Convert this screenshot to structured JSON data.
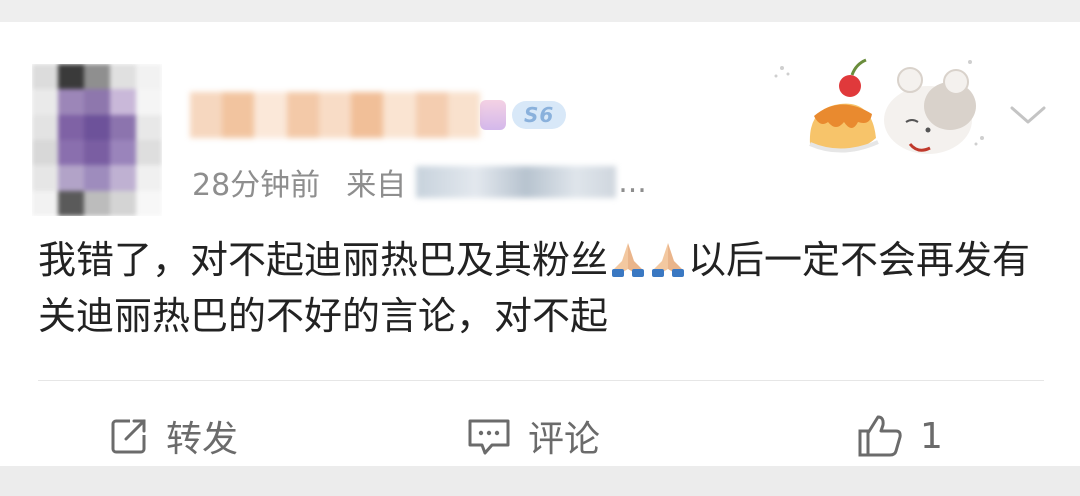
{
  "post": {
    "time": "28分钟前",
    "source_prefix": "来自",
    "source_tail": "...",
    "badge_level": "S6",
    "text": "我错了，对不起迪丽热巴及其粉丝🙏🙏以后一定不会再发有关迪丽热巴的不好的言论，对不起",
    "text_before_emoji": "我错了，对不起迪丽热巴及其粉丝",
    "text_after_emoji": "以后一定不会再发有关迪丽热巴的不好的言论，对不起"
  },
  "actions": {
    "repost_label": "转发",
    "comment_label": "评论",
    "like_count": "1"
  },
  "icons": {
    "repost": "share-edit-icon",
    "comment": "comment-bubble-icon",
    "like": "thumbs-up-icon",
    "more": "chevron-down-icon",
    "emoji": "folded-hands-emoji"
  },
  "colors": {
    "card": "#ffffff",
    "page": "#eeeeee",
    "meta_text": "#8e8e8e",
    "body_text": "#222222",
    "action_text": "#6b6b6b"
  }
}
